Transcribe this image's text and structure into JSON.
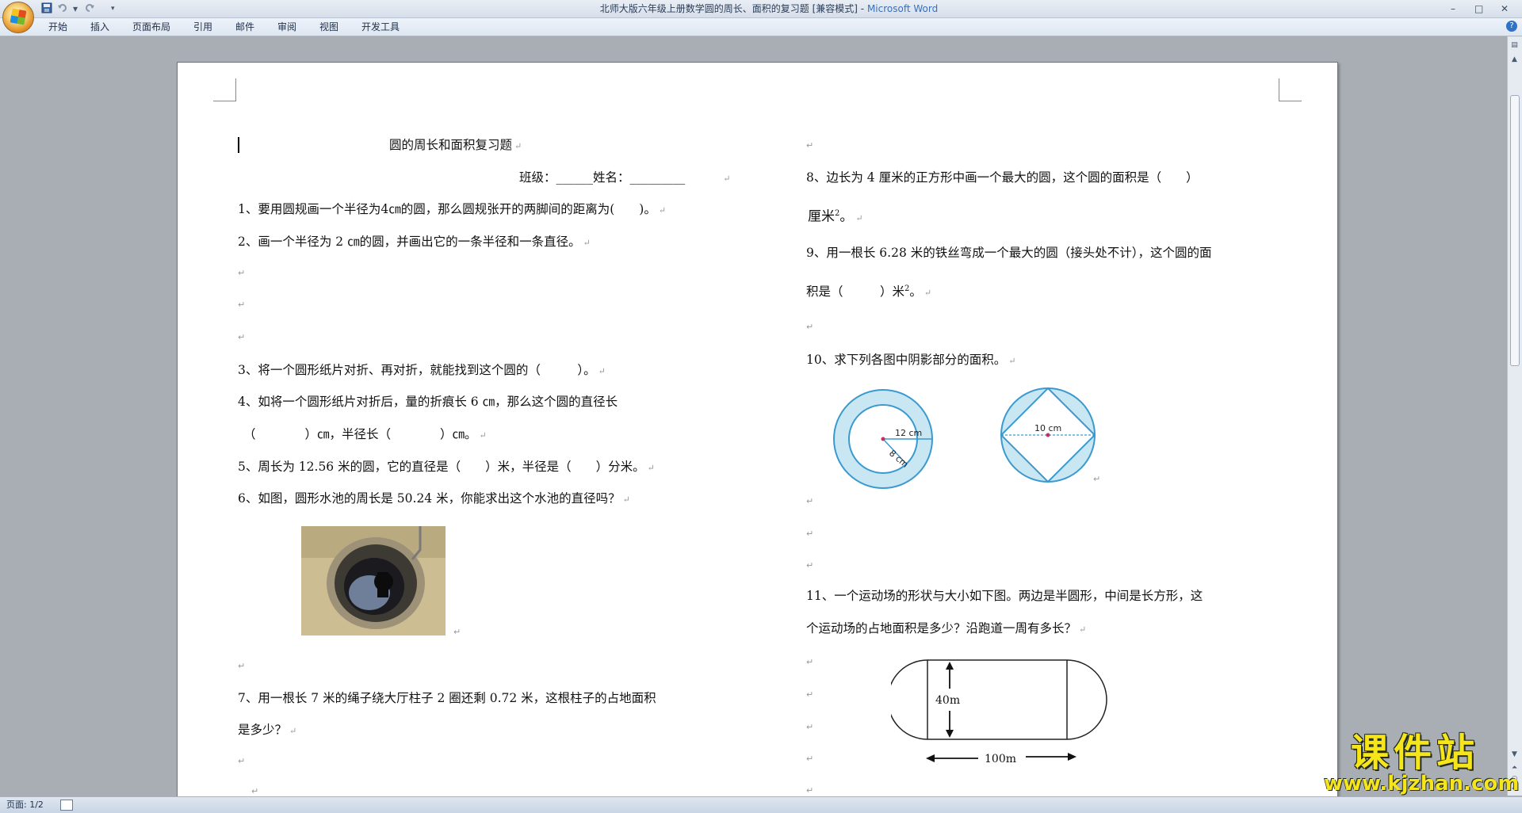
{
  "window": {
    "title": "北师大版六年级上册数学圆的周长、面积的复习题 [兼容模式]",
    "app_name": "Microsoft Word",
    "qat_items": [
      "save-icon",
      "undo-icon",
      "redo-icon",
      "customize-icon"
    ],
    "controls": {
      "minimize": "–",
      "maximize": "□",
      "close": "✕"
    }
  },
  "ribbon": {
    "tabs": [
      "开始",
      "插入",
      "页面布局",
      "引用",
      "邮件",
      "审阅",
      "视图",
      "开发工具"
    ],
    "help": "?"
  },
  "doc": {
    "left": {
      "title": "圆的周长和面积复习题",
      "class_line": "班级：______姓名：_________",
      "q1": "1、要用圆规画一个半径为4㎝的圆，那么圆规张开的两脚间的距离为(　　)。",
      "q2": "2、画一个半径为 2 ㎝的圆，并画出它的一条半径和一条直径。",
      "q3": "3、将一个圆形纸片对折、再对折，就能找到这个圆的（　　　）。",
      "q4a": "4、如将一个圆形纸片对折后，量的折痕长  6  ㎝，那么这个圆的直径长",
      "q4b": "（　　　　）㎝，半径长（　　　　）㎝。",
      "q5": "5、周长为 12.56 米的圆，它的直径是（　　）米，半径是（　　）分米。",
      "q6": "6、如图，圆形水池的周长是 50.24 米，你能求出这个水池的直径吗？",
      "q7a": "7、用一根长 7 米的绳子绕大厅柱子 2 圈还剩 0.72 米，这根柱子的占地面积",
      "q7b": "是多少？"
    },
    "right": {
      "q8a": "8、边长为  4  厘米的正方形中画一个最大的圆，这个圆的面积是（　　）",
      "q8b_unit": "厘米",
      "q8b_tail": "。",
      "q9a": "9、用一根长 6.28 米的铁丝弯成一个最大的圆（接头处不计），这个圆的面",
      "q9b_head": "积是（　　　）米",
      "q9b_tail": "。",
      "q10": "10、求下列各图中阴影部分的面积。",
      "fig1_label1": "12 cm",
      "fig1_label2": "8 cm",
      "fig2_label": "10 cm",
      "q11a": "11、一个运动场的形状与大小如下图。两边是半圆形，中间是长方形，这",
      "q11b": "个运动场的占地面积是多少？沿跑道一周有多长？",
      "field_height": "40m",
      "field_length": "100m"
    },
    "superscript": "2",
    "para_mark": "↵"
  },
  "status": {
    "page": "页面: 1/2"
  },
  "watermark": {
    "cn": "课件站",
    "url": "www.kjzhan.com"
  },
  "colors": {
    "figure_fill": "#c9e6f3",
    "figure_stroke": "#3a9ad0",
    "page_bg": "#ffffff",
    "workspace_bg": "#a9aeb5",
    "watermark": "#f7e51c"
  }
}
